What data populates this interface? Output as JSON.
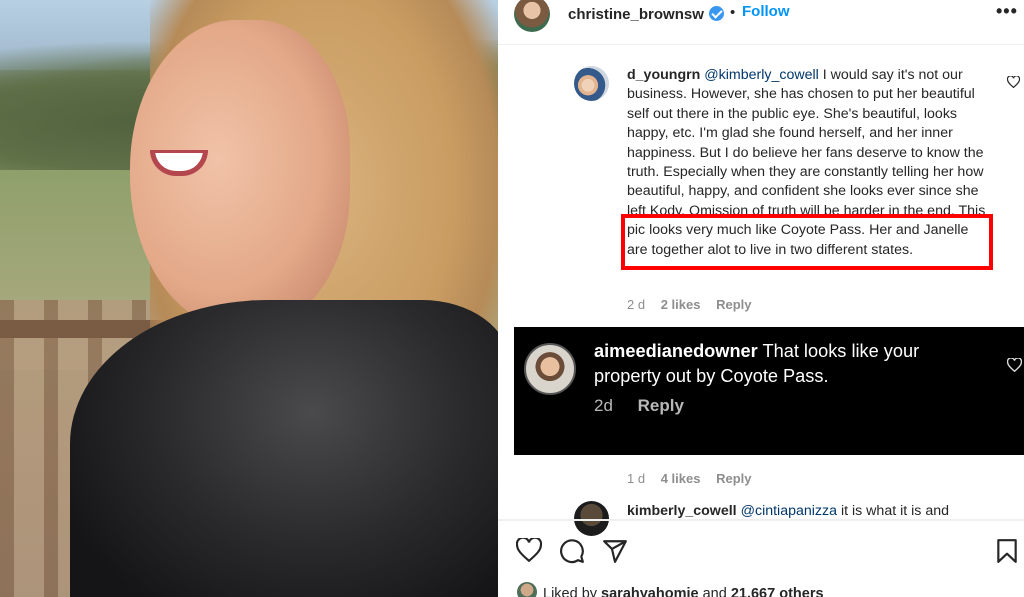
{
  "post": {
    "username": "christine_brownsw",
    "separator": "•",
    "follow_label": "Follow",
    "more_label": "•••"
  },
  "comments": [
    {
      "username": "d_youngrn",
      "mention": "@kimberly_cowell",
      "text_before_highlight": " I would say it's not our business. However, she has chosen to put her beautiful self out there in the public eye. She's beautiful, looks happy, etc. I'm glad she found herself, and her inner happiness. But I do believe her fans deserve to know the truth. Especially when they are constantly telling her how beautiful, happy, and confident she looks ever since she left Kody.",
      "text_highlight": "Omission of truth will be harder in the end. This pic looks very much like Coyote Pass. Her and Janelle",
      "text_after_highlight": "are together alot to live in two different states.",
      "age": "2 d",
      "likes": "2 likes",
      "reply_label": "Reply"
    },
    {
      "username": "aimeedianedowner",
      "text": "That looks like your property out by Coyote Pass.",
      "age": "2d",
      "reply_label": "Reply"
    },
    {
      "age": "1 d",
      "likes": "4 likes",
      "reply_label": "Reply"
    },
    {
      "username": "kimberly_cowell",
      "mention": "@cintiapanizza",
      "text": " it is what it is and"
    }
  ],
  "liked_by": {
    "prefix": "Liked by ",
    "user": "sarahyahomie",
    "middle": " and ",
    "others": "21,667 others"
  },
  "colors": {
    "accent": "#0095f6",
    "highlight_box": "#ff0000",
    "dark_overlay": "#000000"
  },
  "icons": [
    "verified-badge-icon",
    "more-options-icon",
    "heart-icon",
    "comment-icon",
    "share-icon",
    "bookmark-icon"
  ]
}
